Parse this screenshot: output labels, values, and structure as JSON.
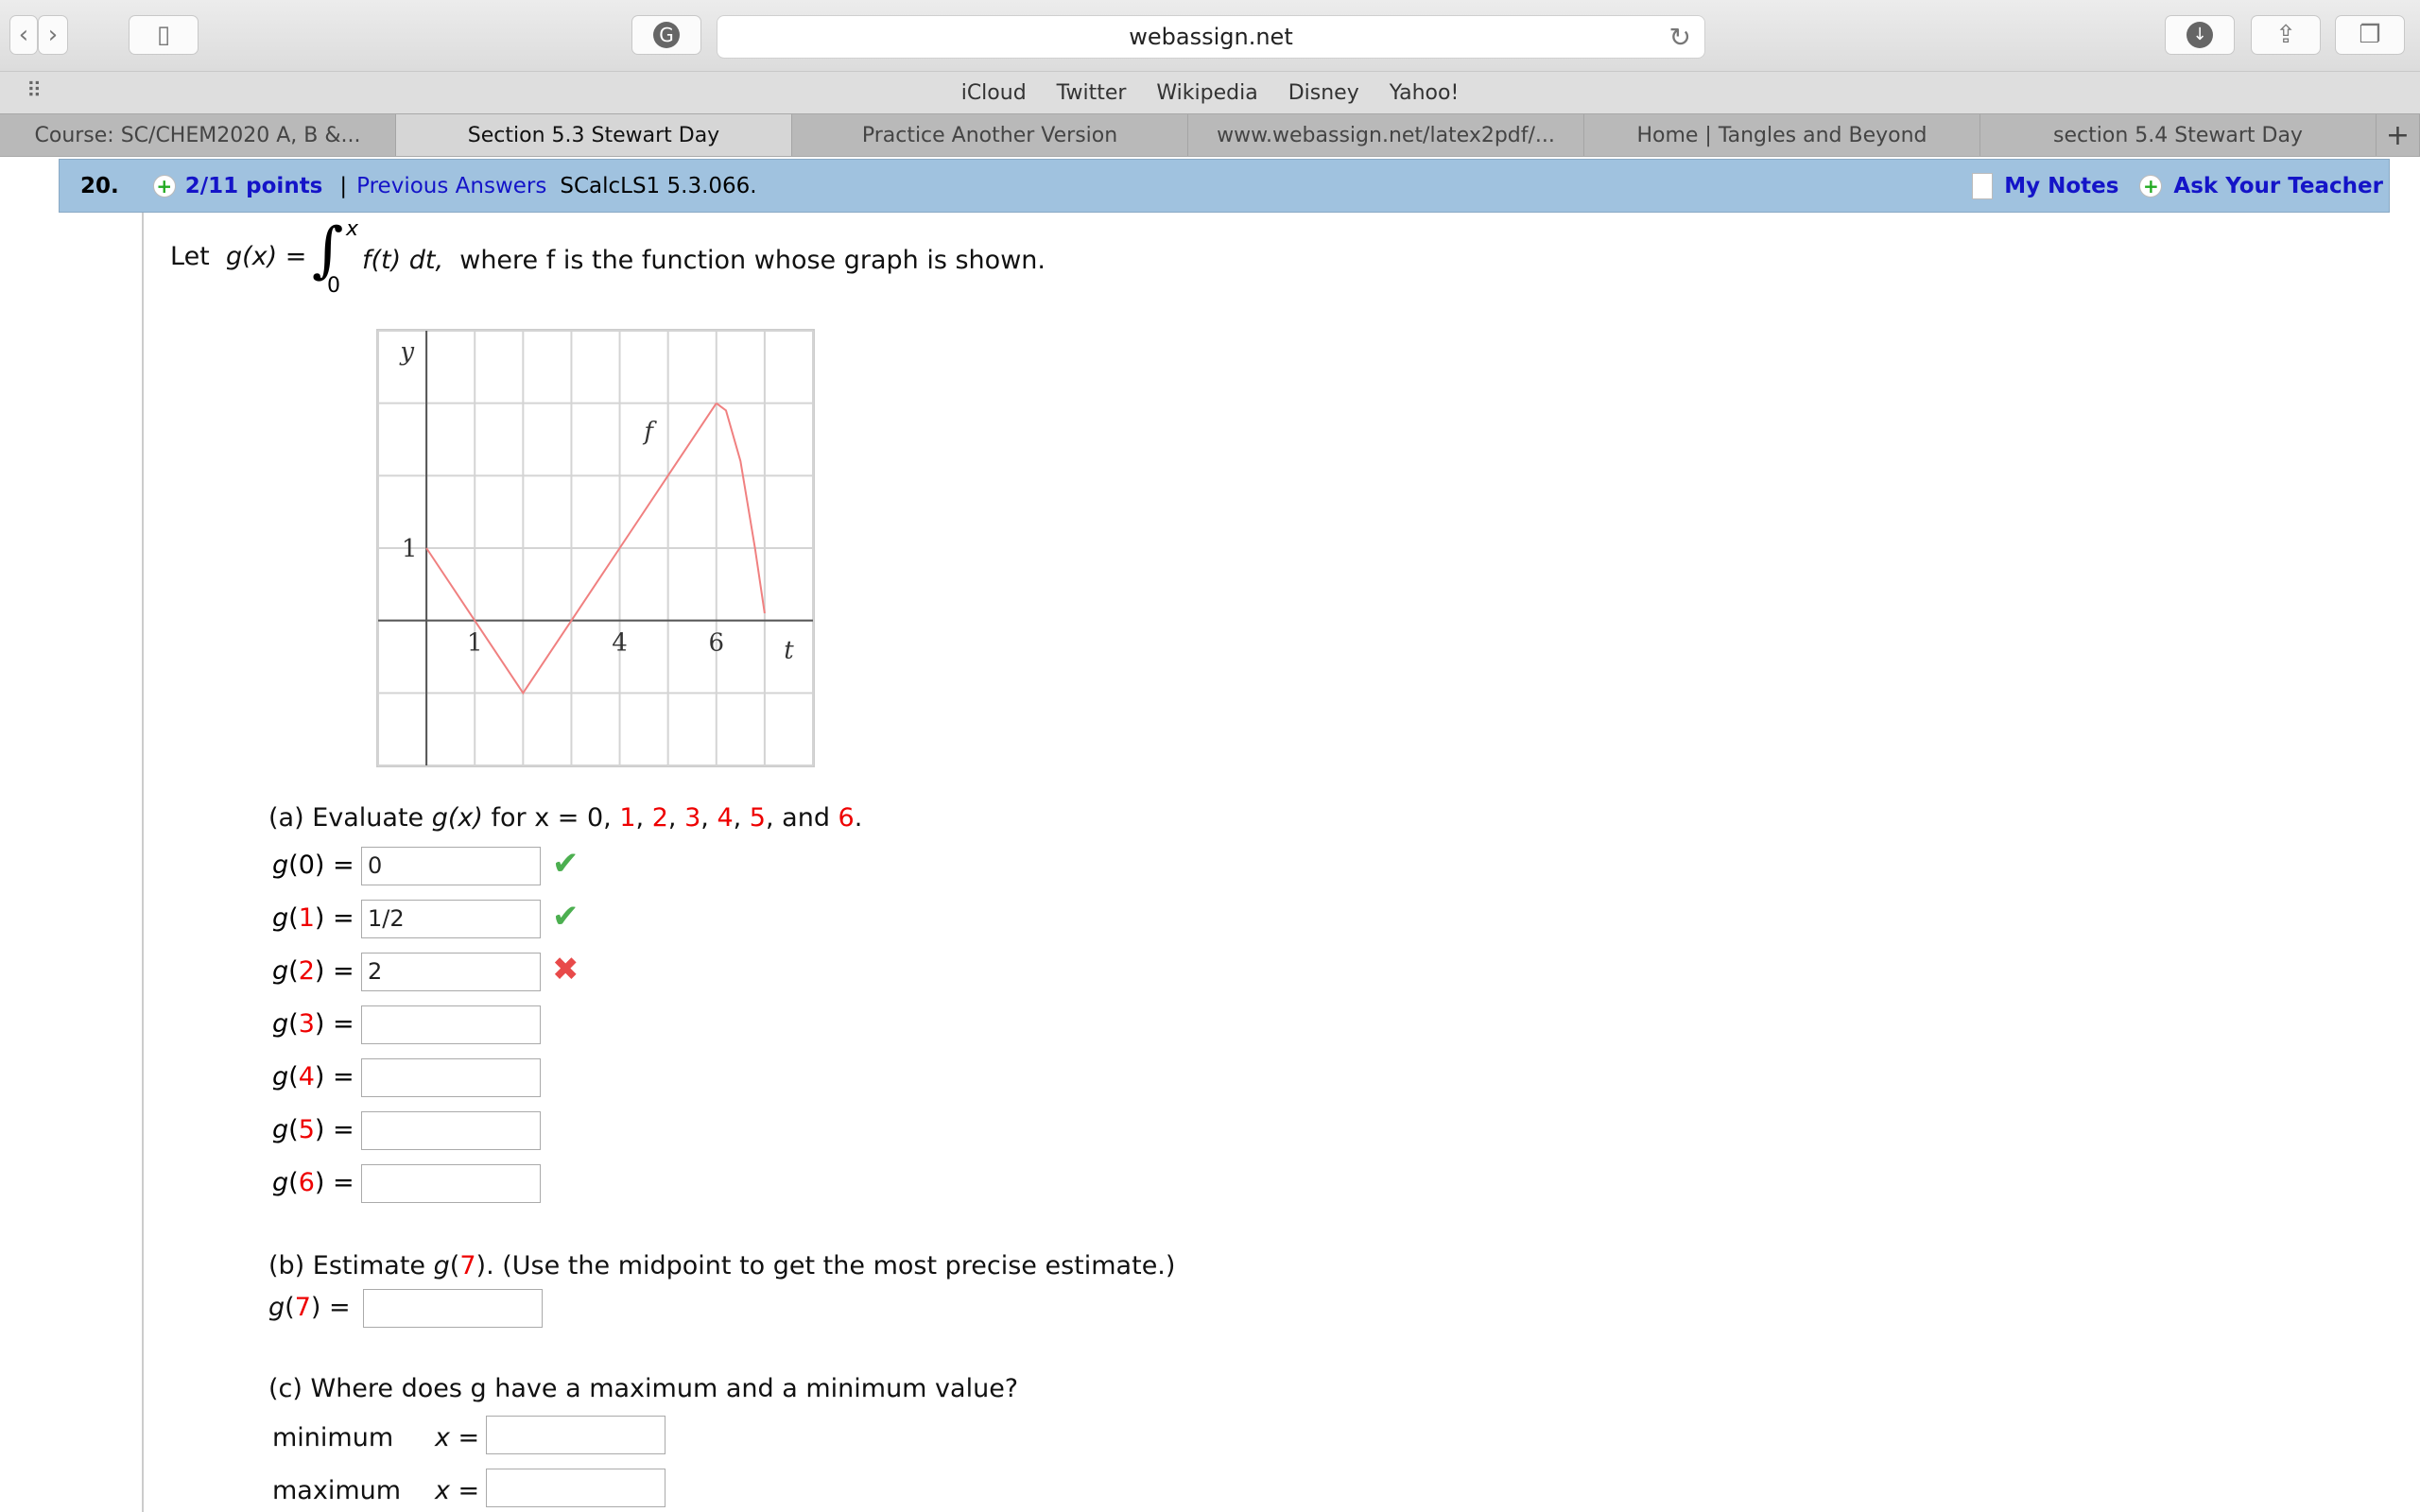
{
  "browser": {
    "url": "webassign.net",
    "bookmarks": [
      "iCloud",
      "Twitter",
      "Wikipedia",
      "Disney",
      "Yahoo!"
    ],
    "tabs": [
      {
        "label": "Course: SC/CHEM2020 A, B &..."
      },
      {
        "label": "Section 5.3 Stewart Day",
        "active": true
      },
      {
        "label": "Practice Another Version"
      },
      {
        "label": "www.webassign.net/latex2pdf/..."
      },
      {
        "label": "Home | Tangles and Beyond"
      },
      {
        "label": "section 5.4 Stewart Day"
      }
    ],
    "new_tab": "+"
  },
  "question": {
    "number": "20.",
    "points": "2/11 points",
    "separator": "|",
    "previous_answers": "Previous Answers",
    "code": "SCalcLS1 5.3.066.",
    "my_notes": "My Notes",
    "ask_teacher": "Ask Your Teacher"
  },
  "prompt": {
    "let": "Let",
    "gx": "g(x) =",
    "upper": "x",
    "lower": "0",
    "integrand": "f(t) dt,",
    "rest": "where f is the function whose graph is shown."
  },
  "chart_data": {
    "type": "line",
    "xlabel": "t",
    "ylabel": "y",
    "series_label": "f",
    "xlim": [
      -1,
      8
    ],
    "ylim": [
      -2,
      4
    ],
    "grid": true,
    "x_tick_labels": [
      "1",
      "4",
      "6"
    ],
    "y_tick_labels": [
      "1"
    ],
    "points": [
      [
        0,
        1
      ],
      [
        1,
        0
      ],
      [
        2,
        -1
      ],
      [
        3,
        0
      ],
      [
        4,
        1
      ],
      [
        5,
        2
      ],
      [
        6,
        3
      ]
    ],
    "curve": [
      [
        6,
        3
      ],
      [
        6.2,
        2.9
      ],
      [
        6.5,
        2.2
      ],
      [
        6.8,
        1.0
      ],
      [
        7,
        0.1
      ]
    ]
  },
  "part_a": {
    "label": "(a) Evaluate",
    "gx": "g(x)",
    "for_x": "for x = 0,",
    "values": [
      "1",
      "2",
      "3",
      "4",
      "5",
      "6"
    ],
    "and": "and",
    "rows": [
      {
        "arg": "0",
        "value": "0",
        "status": "correct"
      },
      {
        "arg": "1",
        "value": "1/2",
        "status": "correct"
      },
      {
        "arg": "2",
        "value": "2",
        "status": "incorrect"
      },
      {
        "arg": "3",
        "value": ""
      },
      {
        "arg": "4",
        "value": ""
      },
      {
        "arg": "5",
        "value": ""
      },
      {
        "arg": "6",
        "value": ""
      }
    ]
  },
  "part_b": {
    "label": "(b) Estimate",
    "arg": "7",
    "note": ". (Use the midpoint to get the most precise estimate.)",
    "value": ""
  },
  "part_c": {
    "label": "(c) Where does g have a maximum and a minimum value?",
    "minimum": "minimum",
    "maximum": "maximum",
    "x_eq": "x =",
    "min_value": "",
    "max_value": ""
  },
  "colors": {
    "header": "#a0c2df",
    "link": "#1414c8",
    "highlight": "#e00000",
    "curve": "#f08080"
  }
}
